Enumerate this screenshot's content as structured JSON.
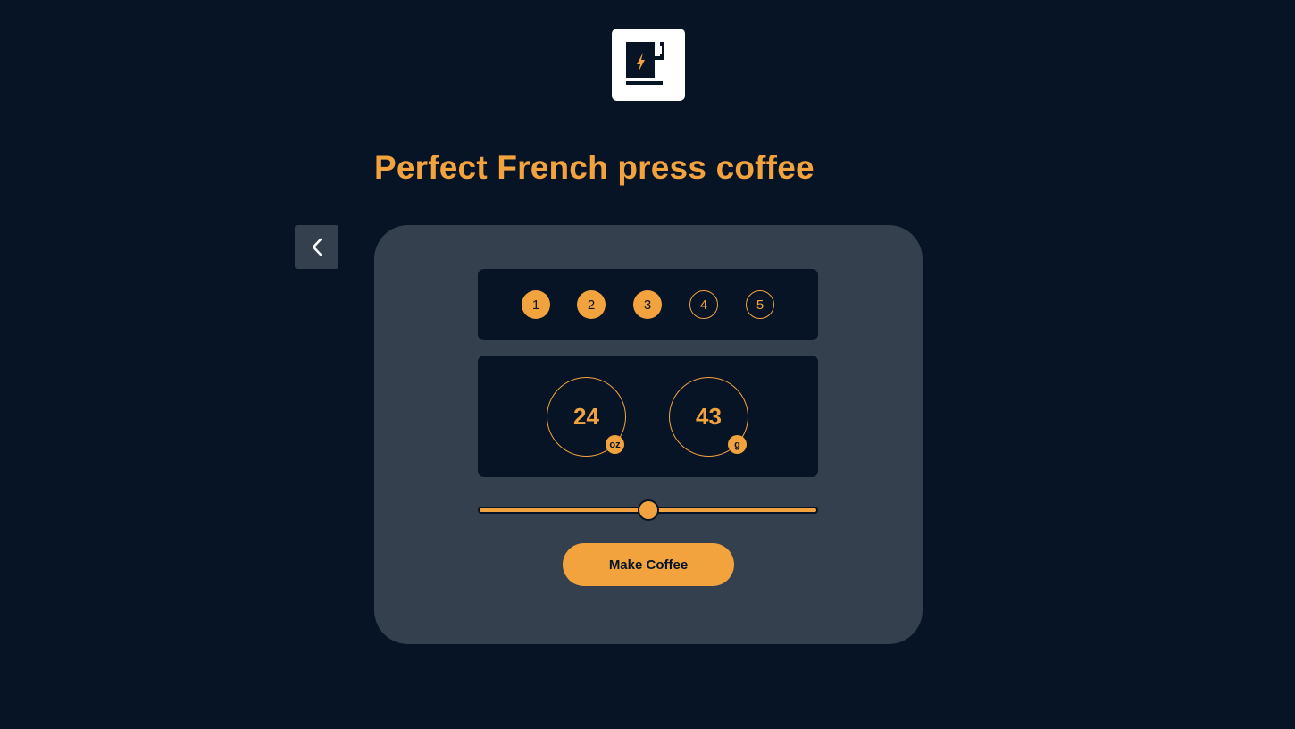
{
  "app": {
    "logo_icon": "coffee-cup-bolt-icon"
  },
  "header": {
    "title": "Perfect French press coffee"
  },
  "nav": {
    "back_icon": "chevron-left-icon"
  },
  "steps": {
    "items": [
      {
        "label": "1",
        "completed": true
      },
      {
        "label": "2",
        "completed": true
      },
      {
        "label": "3",
        "completed": true
      },
      {
        "label": "4",
        "completed": false
      },
      {
        "label": "5",
        "completed": false
      }
    ]
  },
  "measurements": {
    "water": {
      "value": "24",
      "unit": "oz"
    },
    "coffee": {
      "value": "43",
      "unit": "g"
    }
  },
  "slider": {
    "value_fraction": 0.5
  },
  "actions": {
    "make_coffee_label": "Make Coffee"
  },
  "colors": {
    "background": "#061426",
    "card": "#34404d",
    "accent": "#f3a33e",
    "logo_bg": "#ffffff"
  }
}
